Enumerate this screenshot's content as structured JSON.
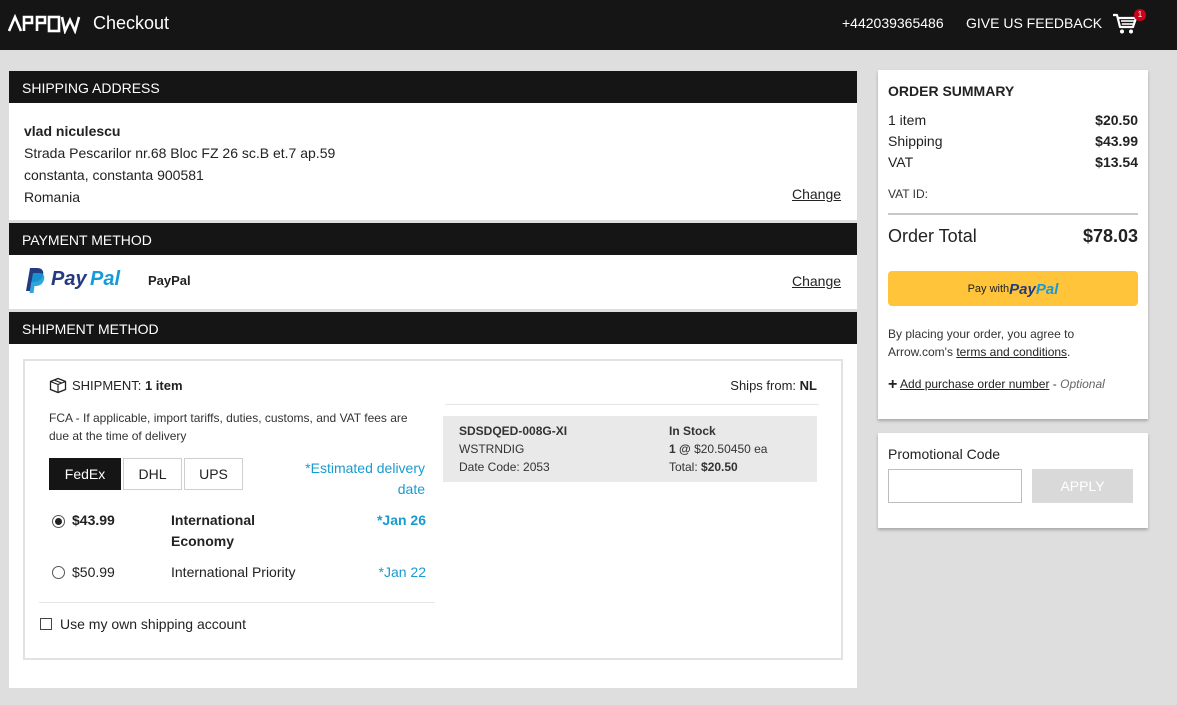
{
  "header": {
    "logo_text": "ARROW",
    "title": "Checkout",
    "phone": "+442039365486",
    "feedback_label": "GIVE US FEEDBACK",
    "cart_count": "1",
    "cart_icon": "cart-icon"
  },
  "shipping_address": {
    "heading": "SHIPPING ADDRESS",
    "name": "vlad niculescu",
    "line1": "Strada Pescarilor nr.68 Bloc FZ 26 sc.B et.7 ap.59",
    "line2": "constanta, constanta 900581",
    "country": "Romania",
    "change_label": "Change"
  },
  "payment_method": {
    "heading": "PAYMENT METHOD",
    "logo_text_1": "Pay",
    "logo_text_2": "Pal",
    "method_name": "PayPal",
    "change_label": "Change"
  },
  "shipment_method": {
    "heading": "SHIPMENT METHOD",
    "shipment_prefix": "SHIPMENT:",
    "shipment_count": "1 item",
    "ships_from_label": "Ships from:",
    "ships_from_value": "NL",
    "fca_note": "FCA - If applicable, import tariffs, duties, customs, and VAT fees are due at the time of delivery",
    "carriers": [
      {
        "label": "FedEx",
        "active": true
      },
      {
        "label": "DHL",
        "active": false
      },
      {
        "label": "UPS",
        "active": false
      }
    ],
    "estimated_label": "*Estimated delivery date",
    "options": [
      {
        "price": "$43.99",
        "name": "International Economy",
        "date": "*Jan 26",
        "selected": true
      },
      {
        "price": "$50.99",
        "name": "International Priority",
        "date": "*Jan 22",
        "selected": false
      }
    ],
    "own_account_label": "Use my own shipping account",
    "item": {
      "part_number": "SDSDQED-008G-XI",
      "manufacturer": "WSTRNDIG",
      "date_code": "Date Code: 2053",
      "stock": "In Stock",
      "qty": "1 @",
      "unit_price": "$20.50450 ea",
      "total_label": "Total:",
      "total_value": "$20.50"
    }
  },
  "order_summary": {
    "heading": "ORDER SUMMARY",
    "rows": [
      {
        "label": "1 item",
        "value": "$20.50"
      },
      {
        "label": "Shipping",
        "value": "$43.99"
      },
      {
        "label": "VAT",
        "value": "$13.54"
      }
    ],
    "vat_id_label": "VAT ID:",
    "total_label": "Order Total",
    "total_value": "$78.03",
    "paypal_button_prefix": "Pay with",
    "paypal_button_brand_1": "Pay",
    "paypal_button_brand_2": "Pal",
    "agree_text": "By placing your order, you agree to Arrow.com's",
    "terms_label": "terms and conditions",
    "agree_end": ".",
    "po_plus": "+",
    "po_label": "Add purchase order number",
    "po_dash": "-",
    "po_optional": "Optional"
  },
  "promo": {
    "label": "Promotional Code",
    "input_value": "",
    "input_placeholder": "",
    "apply_label": "APPLY"
  },
  "colors": {
    "header_bg": "#151515",
    "accent_blue": "#1a9bd0",
    "paypal_yellow": "#ffc439",
    "paypal_dark": "#253b80",
    "paypal_light": "#179bd7",
    "badge_red": "#d0021b"
  }
}
